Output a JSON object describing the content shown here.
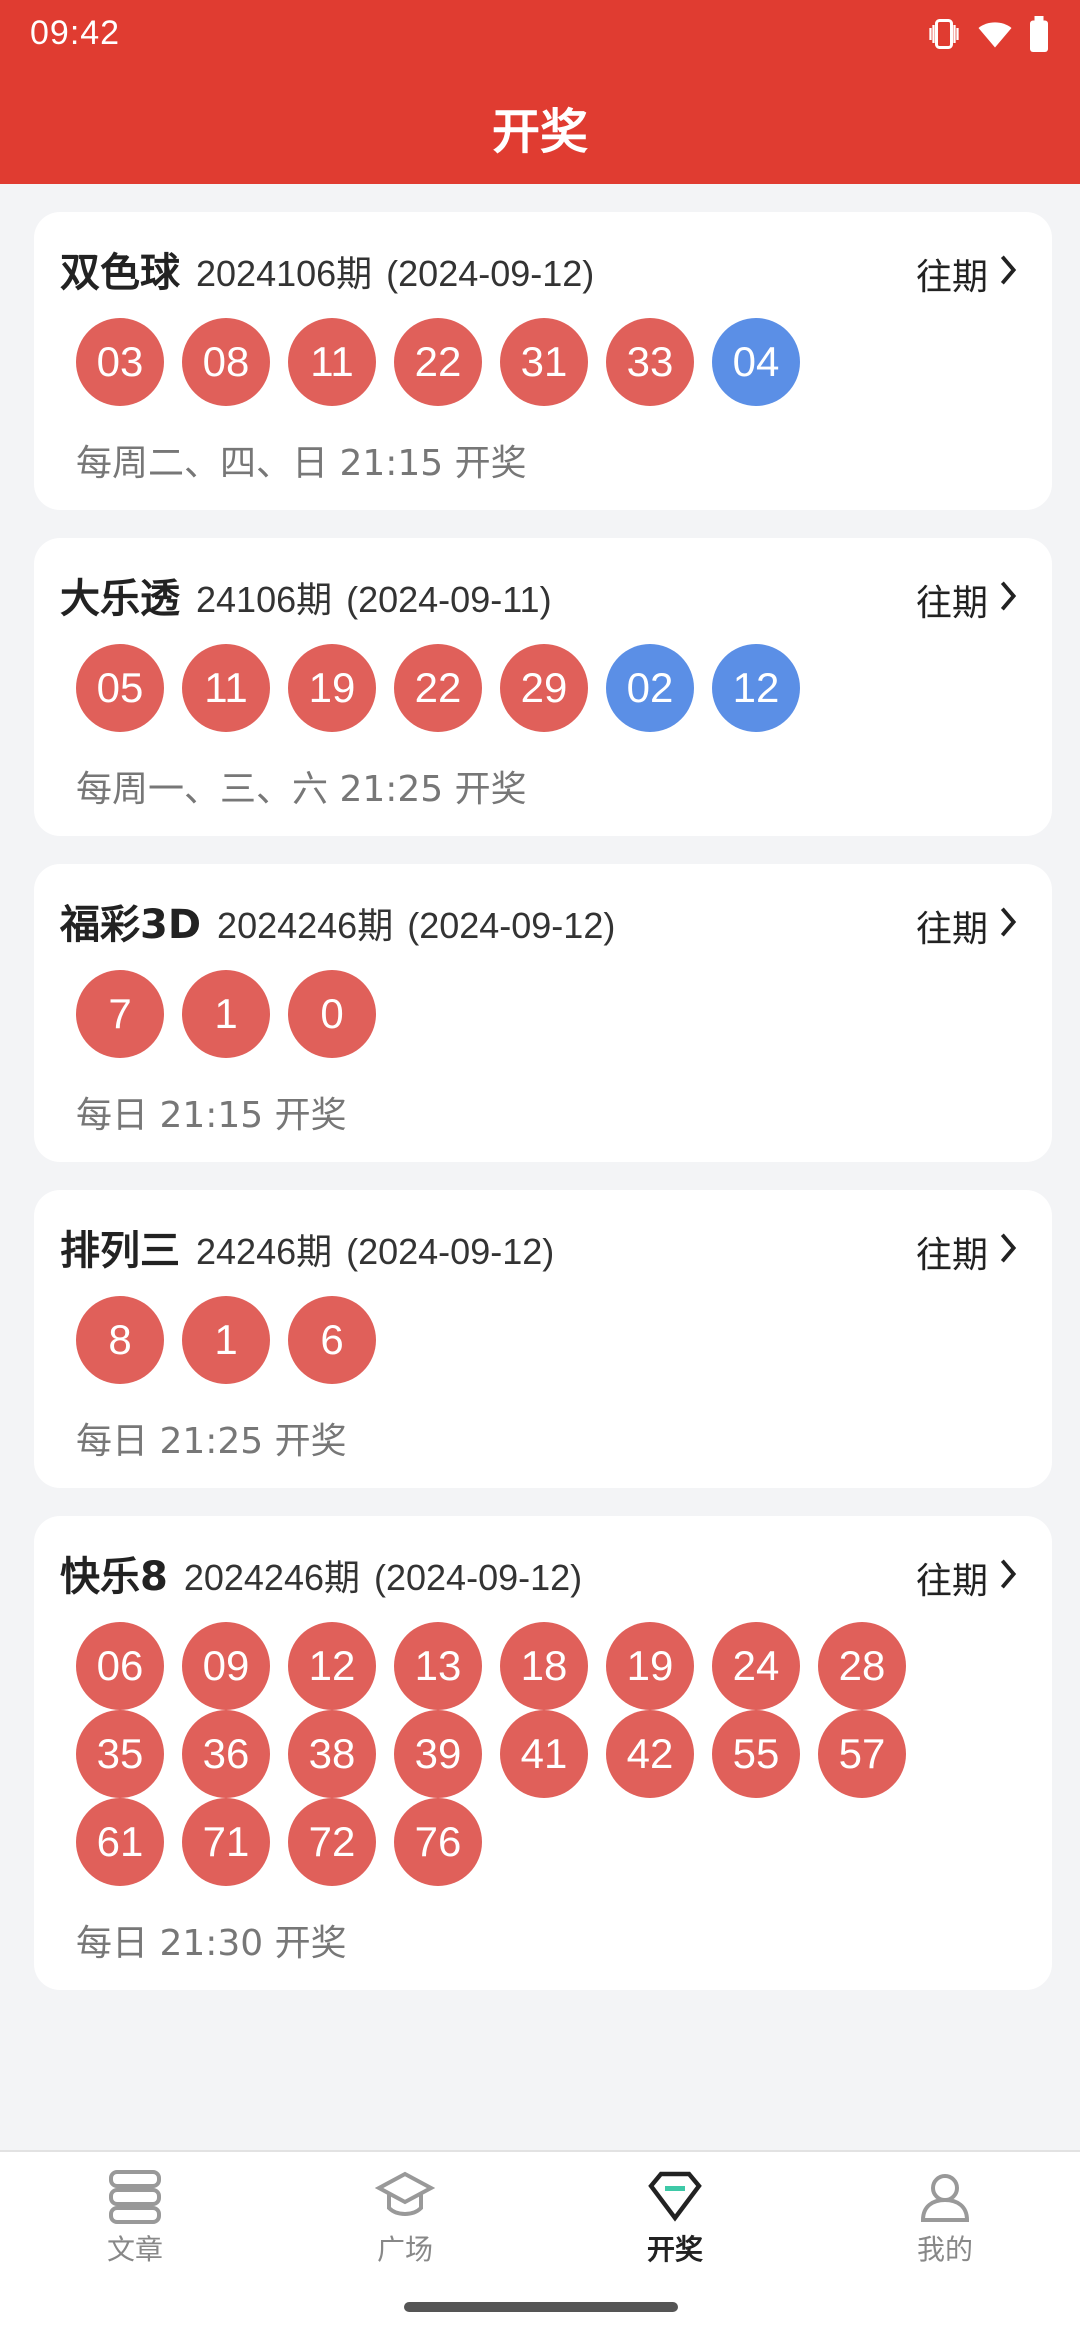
{
  "status": {
    "time": "09:42"
  },
  "header": {
    "title": "开奖"
  },
  "lotteries": [
    {
      "name": "双色球",
      "issue": "2024106期",
      "date": "(2024-09-12)",
      "history_label": "往期",
      "red": [
        "03",
        "08",
        "11",
        "22",
        "31",
        "33"
      ],
      "blue": [
        "04"
      ],
      "schedule": "每周二、四、日 21:15 开奖"
    },
    {
      "name": "大乐透",
      "issue": "24106期",
      "date": "(2024-09-11)",
      "history_label": "往期",
      "red": [
        "05",
        "11",
        "19",
        "22",
        "29"
      ],
      "blue": [
        "02",
        "12"
      ],
      "schedule": "每周一、三、六 21:25 开奖"
    },
    {
      "name": "福彩3D",
      "issue": "2024246期",
      "date": "(2024-09-12)",
      "history_label": "往期",
      "red": [
        "7",
        "1",
        "0"
      ],
      "blue": [],
      "schedule": "每日 21:15 开奖"
    },
    {
      "name": "排列三",
      "issue": "24246期",
      "date": "(2024-09-12)",
      "history_label": "往期",
      "red": [
        "8",
        "1",
        "6"
      ],
      "blue": [],
      "schedule": "每日 21:25 开奖"
    },
    {
      "name": "快乐8",
      "issue": "2024246期",
      "date": "(2024-09-12)",
      "history_label": "往期",
      "red": [
        "06",
        "09",
        "12",
        "13",
        "18",
        "19",
        "24",
        "28",
        "35",
        "36",
        "38",
        "39",
        "41",
        "42",
        "55",
        "57",
        "61",
        "71",
        "72",
        "76"
      ],
      "blue": [],
      "schedule": "每日 21:30 开奖"
    }
  ],
  "nav": [
    {
      "label": "文章",
      "icon": "article-icon",
      "active": false
    },
    {
      "label": "广场",
      "icon": "square-icon",
      "active": false
    },
    {
      "label": "开奖",
      "icon": "lottery-icon",
      "active": true
    },
    {
      "label": "我的",
      "icon": "profile-icon",
      "active": false
    }
  ],
  "colors": {
    "header": "#e03c31",
    "red_ball": "#e0605a",
    "blue_ball": "#5b8fe6",
    "active_accent": "#3ec9a7"
  }
}
